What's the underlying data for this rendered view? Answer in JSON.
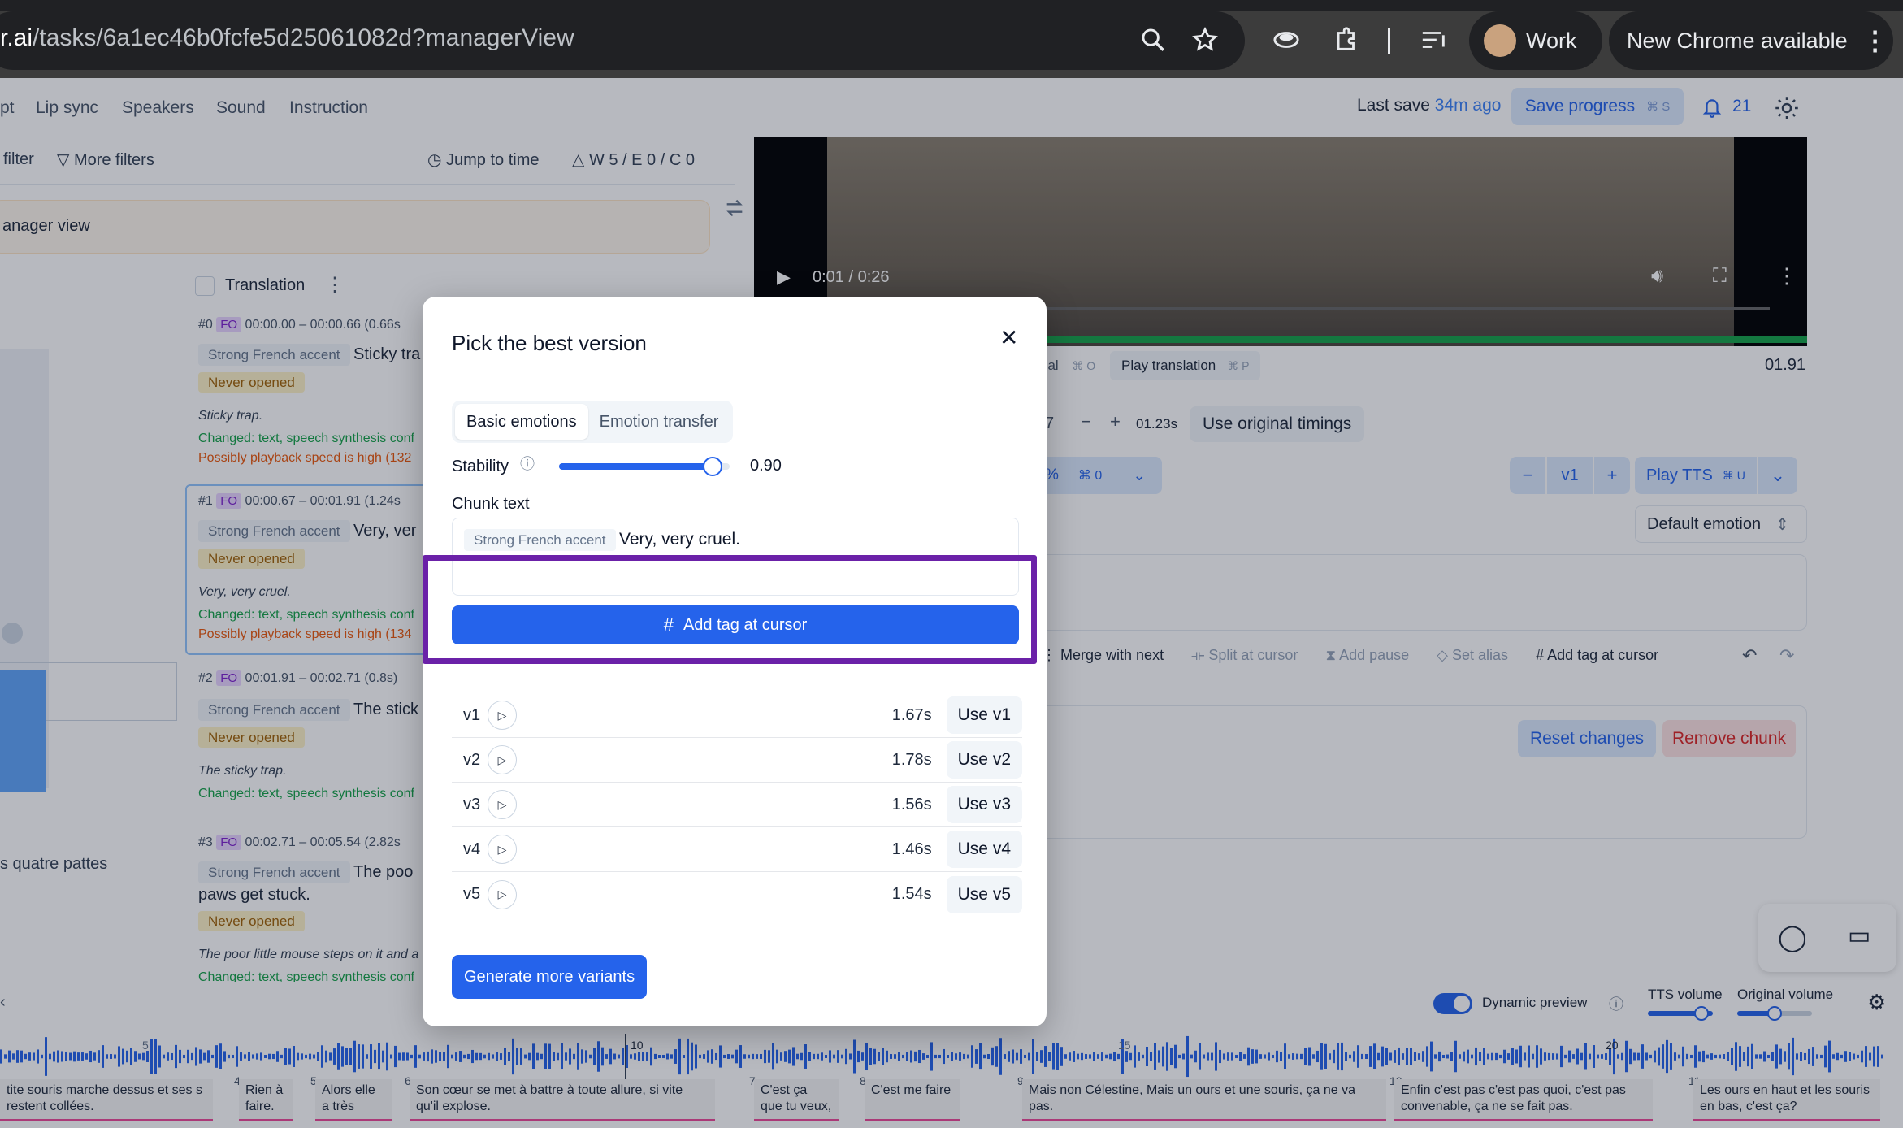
{
  "browser": {
    "url_domain": "r.ai",
    "url_path": "/tasks/6a1ec46b0fcfe5d25061082d?managerView",
    "profile_label": "Work",
    "update_label": "New Chrome available"
  },
  "app_tabs": [
    "pt",
    "Lip sync",
    "Speakers",
    "Sound",
    "Instruction"
  ],
  "header": {
    "last_save_label": "Last save",
    "last_save_value": "34m ago",
    "save_button": "Save progress",
    "save_shortcut": "⌘ S",
    "notifications": "21"
  },
  "filters": {
    "filter_label": "filter",
    "more_filters": "More filters",
    "jump_to_time": "Jump to time",
    "warnings": "W 5 / E 0 / C 0"
  },
  "banner": "anager view",
  "list": {
    "header": "Translation",
    "chunks": [
      {
        "id": "#0",
        "tag": "FO",
        "time": "00:00.00 – 00:00.66 (0.66s",
        "chip": "Strong French accent",
        "text": "Sticky tra",
        "status": "Never opened",
        "orig": "Sticky trap.",
        "changed": "Changed: text, speech synthesis conf",
        "warn": "Possibly playback speed is high (132"
      },
      {
        "id": "#1",
        "tag": "FO",
        "time": "00:00.67 – 00:01.91 (1.24s",
        "chip": "Strong French accent",
        "text": "Very, ver",
        "status": "Never opened",
        "orig": "Very, very cruel.",
        "changed": "Changed: text, speech synthesis conf",
        "warn": "Possibly playback speed is high (134"
      },
      {
        "id": "#2",
        "tag": "FO",
        "time": "00:01.91 – 00:02.71 (0.8s)",
        "chip": "Strong French accent",
        "text": "The stick",
        "status": "Never opened",
        "orig": "The sticky trap.",
        "changed": "Changed: text, speech synthesis conf",
        "warn": ""
      },
      {
        "id": "#3",
        "tag": "FO",
        "time": "00:02.71 – 00:05.54 (2.82s",
        "chip": "Strong French accent",
        "text": "The poo",
        "text2": "paws get stuck.",
        "status": "Never opened",
        "orig": "The poor little mouse steps on it and a",
        "changed": "Changed: text, speech synthesis conf",
        "warn": ""
      }
    ],
    "side_text": "s quatre pattes"
  },
  "video": {
    "time": "0:01 / 0:26"
  },
  "right": {
    "original_label": "nal",
    "original_kbd": "⌘ O",
    "play_translation": "Play translation",
    "play_translation_kbd": "⌘ P",
    "end_time": "01.91",
    "timing_left": "7",
    "timing_value": "01.23s",
    "use_original_timings": "Use original timings",
    "pct": "%",
    "pct_kbd": "⌘ 0",
    "version": "v1",
    "play_tts": "Play TTS",
    "play_tts_kbd": "⌘ U",
    "default_emotion": "Default emotion",
    "tools": [
      "Merge with next",
      "Split at cursor",
      "Add pause",
      "Set alias",
      "Add tag at cursor"
    ],
    "reset": "Reset changes",
    "remove": "Remove chunk",
    "dynamic_preview": "Dynamic preview",
    "tts_volume": "TTS volume",
    "original_volume": "Original volume",
    "tts_volume_level": 0.82,
    "original_volume_level": 0.5
  },
  "modal": {
    "title": "Pick the best version",
    "tabs": [
      "Basic emotions",
      "Emotion transfer"
    ],
    "stability_label": "Stability",
    "stability_value": "0.90",
    "stability_level": 0.9,
    "chunk_text_label": "Chunk text",
    "chunk_chip": "Strong French accent",
    "chunk_text": "Very, very cruel.",
    "add_tag": "Add tag at cursor",
    "versions": [
      {
        "label": "v1",
        "duration": "1.67s",
        "button": "Use v1"
      },
      {
        "label": "v2",
        "duration": "1.78s",
        "button": "Use v2"
      },
      {
        "label": "v3",
        "duration": "1.56s",
        "button": "Use v3"
      },
      {
        "label": "v4",
        "duration": "1.46s",
        "button": "Use v4"
      },
      {
        "label": "v5",
        "duration": "1.54s",
        "button": "Use v5"
      }
    ],
    "generate": "Generate more variants",
    "highlight_color": "#6b21a8"
  },
  "timeline": {
    "ticks": [
      "5",
      "10",
      "15",
      "20"
    ],
    "segments": [
      {
        "num": "",
        "text": "tite souris marche dessus et ses s restent collées."
      },
      {
        "num": "4",
        "text": "Rien à faire."
      },
      {
        "num": "5",
        "text": "Alors elle a très"
      },
      {
        "num": "6",
        "text": "Son cœur se met à battre à toute allure, si vite qu'il explose."
      },
      {
        "num": "7",
        "text": "C'est ça que tu veux,"
      },
      {
        "num": "8",
        "text": "C'est me faire"
      },
      {
        "num": "9",
        "text": "Mais non Célestine, Mais un ours et une souris, ça ne va pas."
      },
      {
        "num": "10",
        "text": "Enfin c'est pas c'est pas quoi, c'est pas convenable, ça ne se fait pas."
      },
      {
        "num": "11",
        "text": "Les ours en haut et les souris en bas, c'est ça?"
      }
    ]
  }
}
